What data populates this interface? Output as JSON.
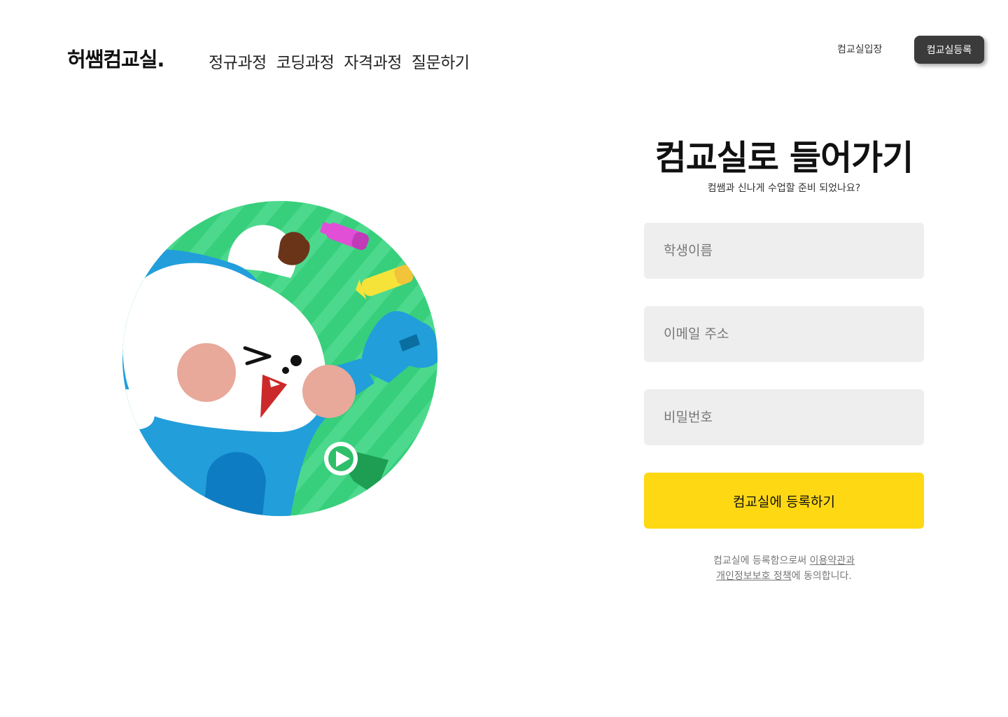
{
  "header": {
    "logo": "허쌤컴교실.",
    "nav": [
      {
        "label": "정규과정"
      },
      {
        "label": "코딩과정"
      },
      {
        "label": "자격과정"
      },
      {
        "label": "질문하기"
      }
    ],
    "login_link": "컴교실입장",
    "register_button": "컴교실등록"
  },
  "illustration": {
    "icon": "mascot-cheering-illustration",
    "colors": {
      "background_green": "#3dd07d",
      "mascot_blue": "#229edb",
      "cheek_pink": "#e8a89a"
    }
  },
  "form": {
    "title": "컴교실로 들어가기",
    "subtitle": "컴쌤과 신나게 수업할 준비 되었나요?",
    "name_placeholder": "학생이름",
    "email_placeholder": "이메일 주소",
    "password_placeholder": "비밀번호",
    "submit_label": "컴교실에 등록하기",
    "terms": {
      "part1": "컴교실에 등록함으로써 ",
      "terms_link": "이용약관과",
      "privacy_link": "개인정보보호 정책",
      "part2": "에 동의합니다."
    },
    "colors": {
      "field_bg": "#eeeeee",
      "submit_bg": "#ffd814"
    }
  }
}
